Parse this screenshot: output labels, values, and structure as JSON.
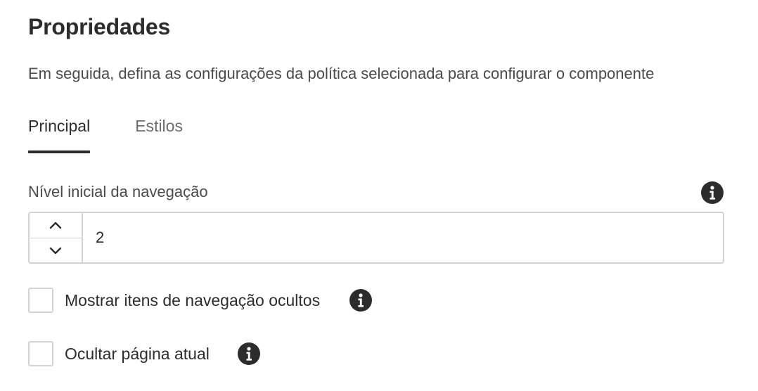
{
  "header": {
    "title": "Propriedades",
    "subtitle": "Em seguida, defina as configurações da política selecionada para configurar o componente"
  },
  "tabs": [
    {
      "label": "Principal",
      "active": true
    },
    {
      "label": "Estilos",
      "active": false
    }
  ],
  "nav_level": {
    "label": "Nível inicial da navegação",
    "value": "2",
    "icon": "info-icon"
  },
  "checkboxes": [
    {
      "label": "Mostrar itens de navegação ocultos",
      "checked": false,
      "icon": "info-icon"
    },
    {
      "label": "Ocultar página atual",
      "checked": false,
      "icon": "info-icon"
    }
  ],
  "colors": {
    "text": "#2c2c2c",
    "muted": "#4b4b4b",
    "border": "#d3d3d3",
    "active_tab_underline": "#2c2c2c"
  }
}
